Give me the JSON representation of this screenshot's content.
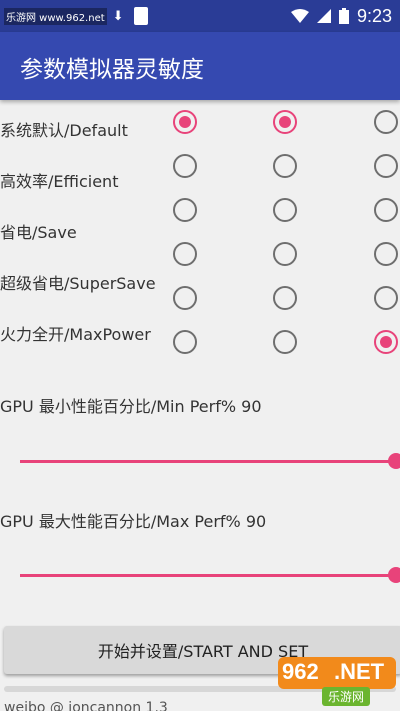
{
  "status_bar": {
    "watermark": "乐游网 www.962.net",
    "time": "9:23",
    "icons": [
      "notification-a-icon",
      "download-icon",
      "app-icon",
      "wifi-icon",
      "signal-icon",
      "battery-icon"
    ]
  },
  "app_bar": {
    "title": "参数模拟器灵敏度"
  },
  "modes": [
    {
      "label": "系统默认/Default"
    },
    {
      "label": "高效率/Efficient"
    },
    {
      "label": "省电/Save"
    },
    {
      "label": "超级省电/SuperSave"
    },
    {
      "label": "火力全开/MaxPower"
    }
  ],
  "radio_columns": [
    {
      "column": 1,
      "rows": [
        true,
        false,
        false,
        false,
        false,
        false
      ]
    },
    {
      "column": 2,
      "rows": [
        true,
        false,
        false,
        false,
        false,
        false
      ]
    },
    {
      "column": 3,
      "rows": [
        false,
        false,
        false,
        false,
        false,
        true
      ]
    }
  ],
  "gpu_min": {
    "label": "GPU 最小性能百分比/Min Perf% 90",
    "value_fraction": 1.0
  },
  "gpu_max": {
    "label": "GPU 最大性能百分比/Max Perf% 90",
    "value_fraction": 1.0
  },
  "start_button": {
    "label": "开始并设置/START AND SET"
  },
  "footer": {
    "credit": "weibo @ joncannon 1.3"
  },
  "watermark_logo": {
    "number": "962",
    "suffix": ".NET",
    "sub": "乐游网"
  },
  "colors": {
    "accent": "#e8437a",
    "app_bar": "#3549b0",
    "status_bar": "#2a3c96"
  }
}
